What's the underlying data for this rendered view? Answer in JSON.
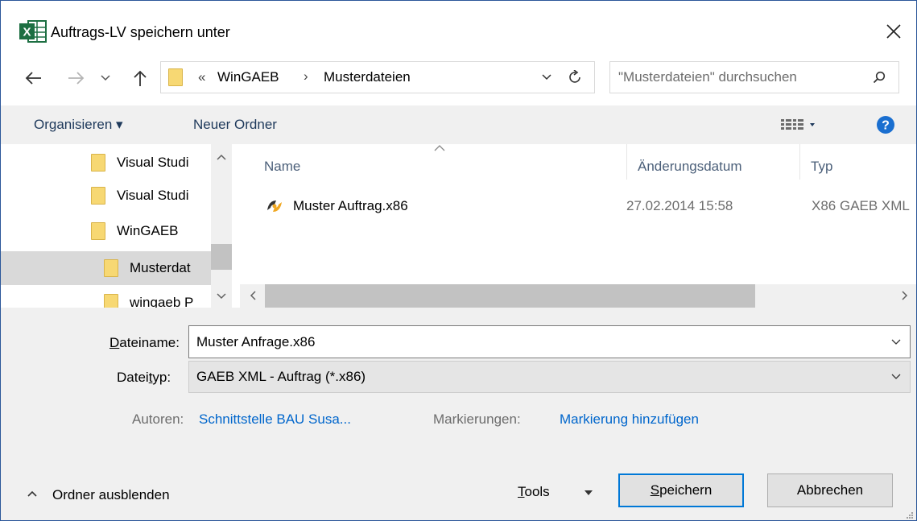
{
  "title": "Auftrags-LV speichern unter",
  "icons": {
    "app": "excel-icon",
    "close": "close-icon",
    "back": "back-arrow-icon",
    "forward": "forward-arrow-icon",
    "recent": "chevron-down-icon",
    "up": "up-arrow-icon",
    "refresh": "refresh-icon",
    "search": "search-icon",
    "help": "help-icon",
    "view": "view-options-icon"
  },
  "breadcrumb": {
    "overflow": "«",
    "items": [
      "WinGAEB",
      "Musterdateien"
    ],
    "separator": "›"
  },
  "search": {
    "placeholder": "\"Musterdateien\" durchsuchen"
  },
  "toolbar": {
    "organize": "Organisieren ▾",
    "new_folder": "Neuer Ordner"
  },
  "tree": {
    "items": [
      {
        "label": "Visual Studi",
        "selected": false
      },
      {
        "label": "Visual Studi",
        "selected": false
      },
      {
        "label": "WinGAEB",
        "selected": false
      },
      {
        "label": "Musterdat",
        "selected": true
      },
      {
        "label": "wingaeb P",
        "selected": false
      }
    ]
  },
  "list": {
    "columns": [
      "Name",
      "Änderungsdatum",
      "Typ"
    ],
    "rows": [
      {
        "name": "Muster Auftrag.x86",
        "date": "27.02.2014 15:58",
        "type": "X86 GAEB XML"
      }
    ]
  },
  "form": {
    "filename_label_accel": "D",
    "filename_label_rest": "ateiname:",
    "filename_value": "Muster Anfrage.x86",
    "filetype_label_pre": "Datei",
    "filetype_label_accel": "t",
    "filetype_label_post": "yp:",
    "filetype_value": "GAEB XML - Auftrag (*.x86)",
    "authors_label": "Autoren:",
    "authors_value": "Schnittstelle BAU Susa...",
    "tags_label": "Markierungen:",
    "tags_value": "Markierung hinzufügen"
  },
  "footer": {
    "hide_folders": "Ordner ausblenden",
    "tools_accel": "T",
    "tools_rest": "ools",
    "save_accel": "S",
    "save_rest": "peichern",
    "cancel": "Abbrechen"
  },
  "colors": {
    "accent": "#0066cc",
    "border_accent": "#2b579a",
    "help": "#1a6fd0",
    "excel": "#1d6f42",
    "folder": "#f7d873"
  }
}
